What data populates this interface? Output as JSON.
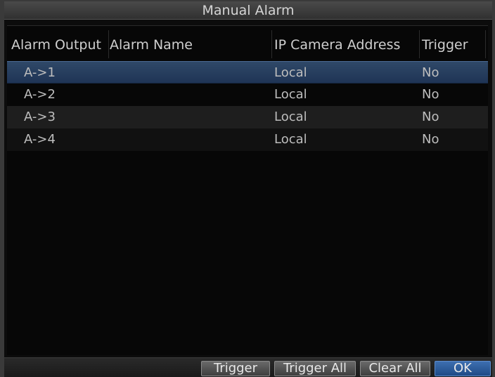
{
  "window": {
    "title": "Manual Alarm"
  },
  "table": {
    "headers": {
      "alarm_output": "Alarm Output",
      "alarm_name": "Alarm Name",
      "ip_camera_address": "IP Camera Address",
      "trigger": "Trigger"
    },
    "rows": [
      {
        "alarm_output": "A->1",
        "alarm_name": "",
        "ip_camera_address": "Local",
        "trigger": "No",
        "selected": true
      },
      {
        "alarm_output": "A->2",
        "alarm_name": "",
        "ip_camera_address": "Local",
        "trigger": "No",
        "selected": false
      },
      {
        "alarm_output": "A->3",
        "alarm_name": "",
        "ip_camera_address": "Local",
        "trigger": "No",
        "selected": false
      },
      {
        "alarm_output": "A->4",
        "alarm_name": "",
        "ip_camera_address": "Local",
        "trigger": "No",
        "selected": false
      }
    ]
  },
  "buttons": {
    "trigger": "Trigger",
    "trigger_all": "Trigger All",
    "clear_all": "Clear All",
    "ok": "OK"
  },
  "colors": {
    "selected_row": "#2f4868",
    "primary_button": "#2a5b9c",
    "titlebar": "#3c3c3c"
  }
}
